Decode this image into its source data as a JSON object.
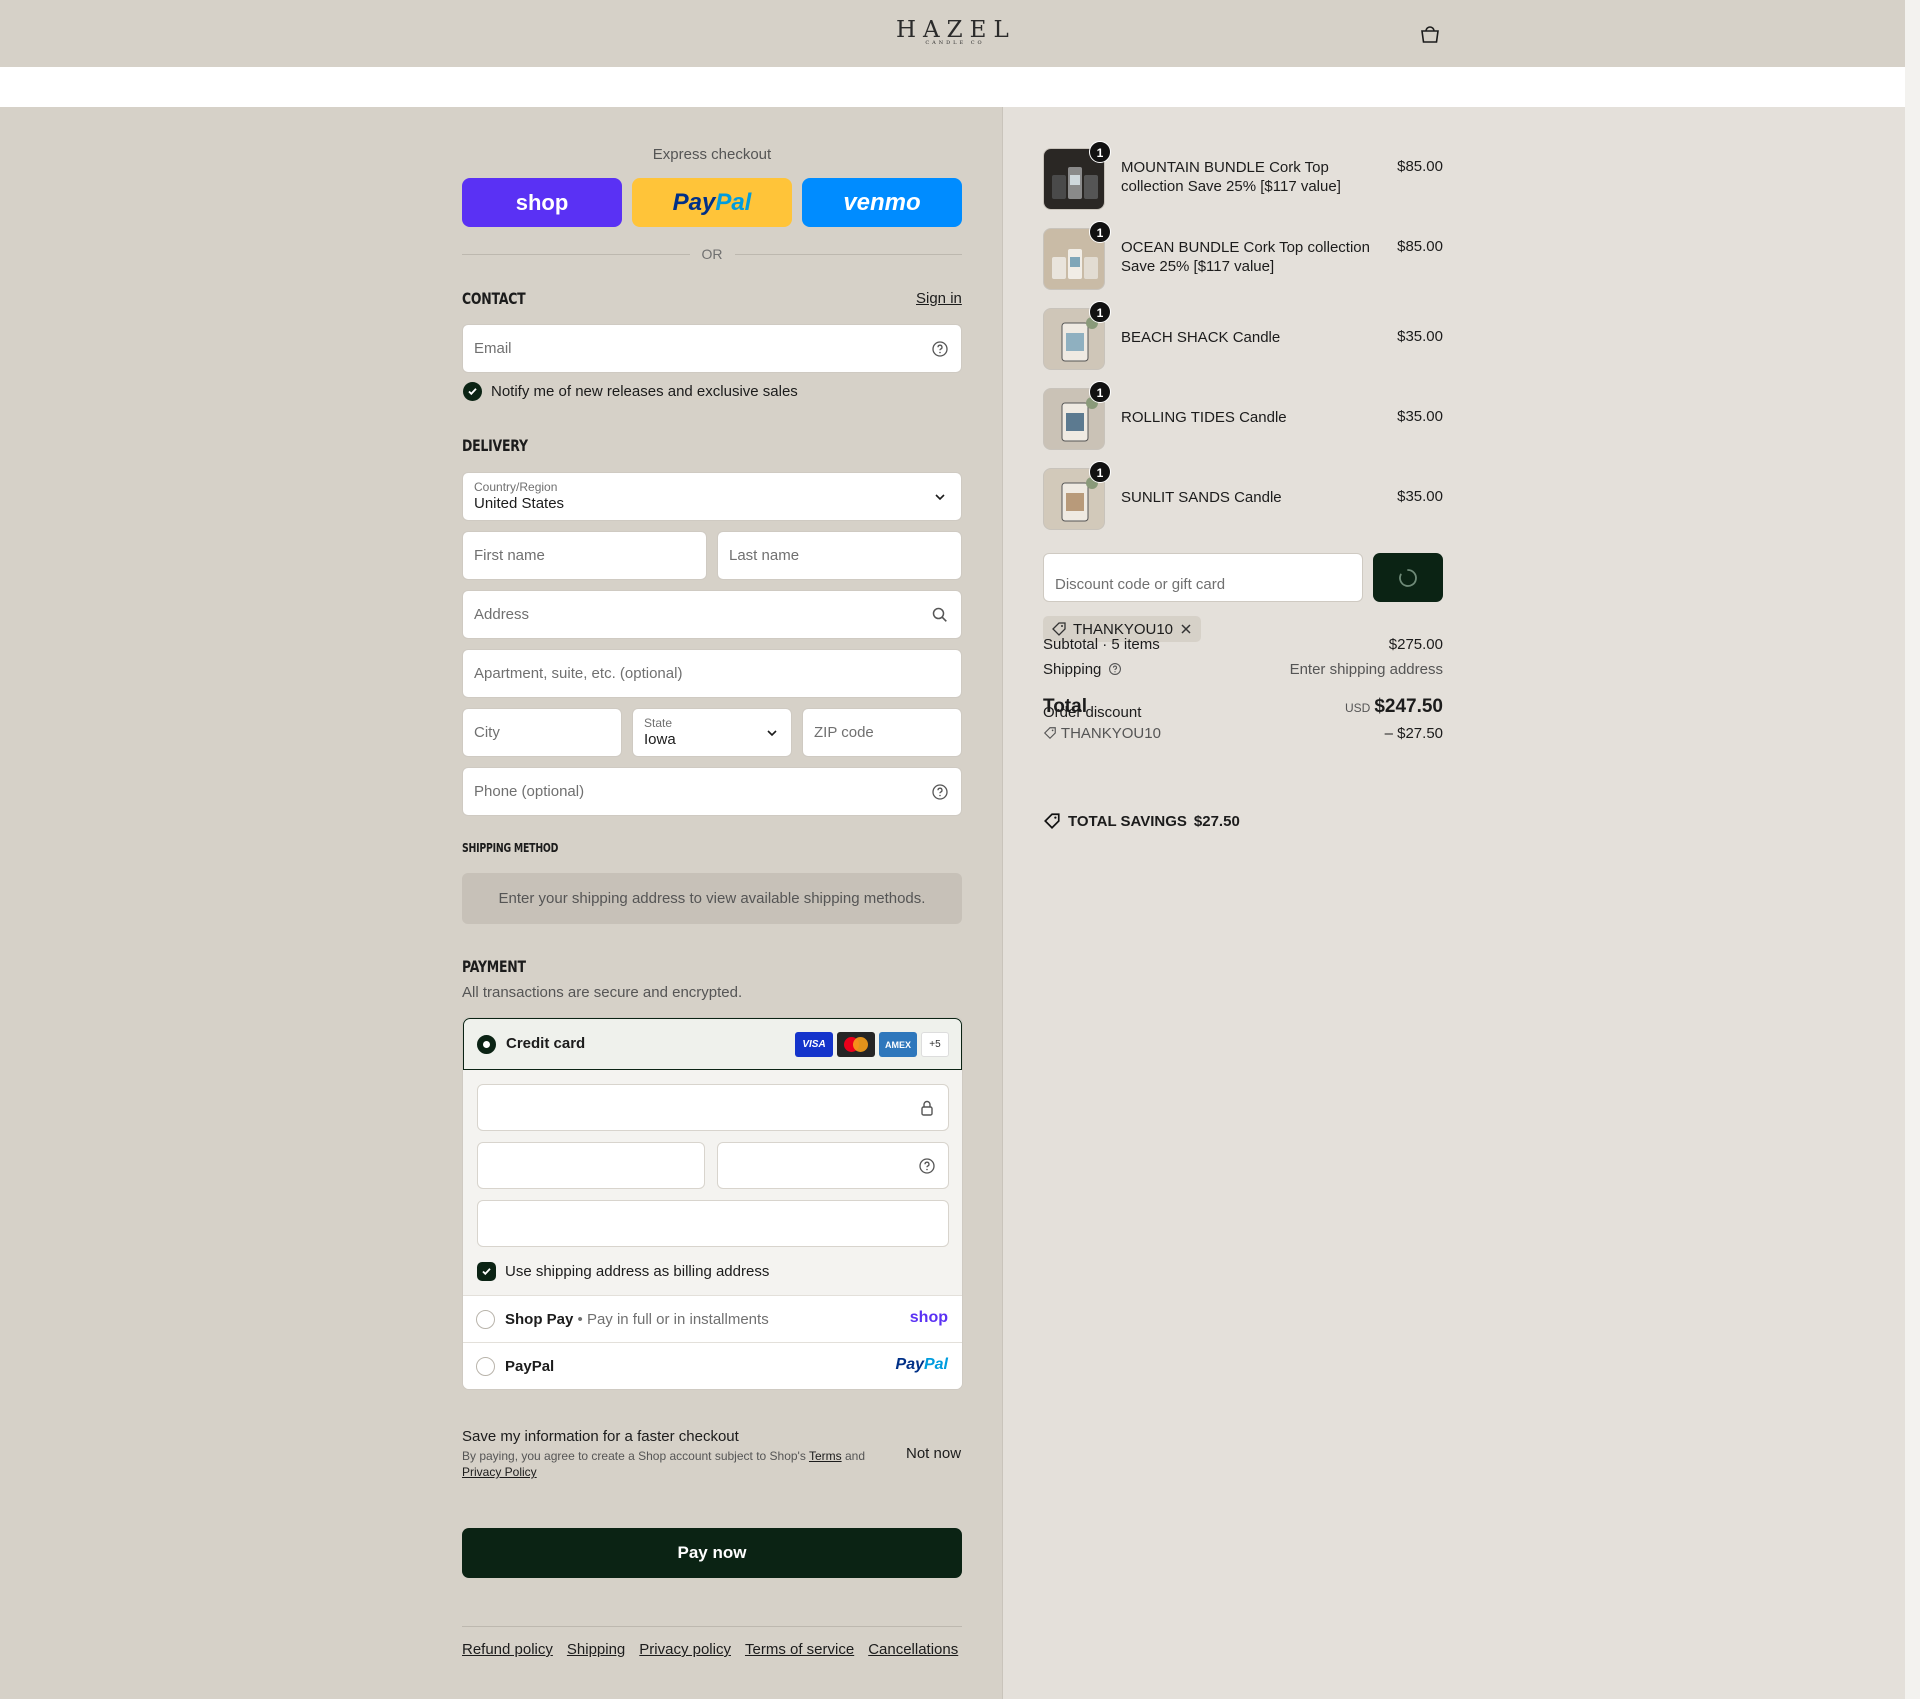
{
  "header": {
    "logo_main": "HAZEL",
    "logo_sub": "CANDLE CO",
    "cart_icon": "bag-icon"
  },
  "express": {
    "title": "Express checkout",
    "shop_label": "shop",
    "paypal_part1": "Pay",
    "paypal_part2": "Pal",
    "venmo_label": "venmo",
    "or_label": "OR"
  },
  "contact": {
    "heading": "CONTACT",
    "sign_in": "Sign in",
    "email_placeholder": "Email",
    "notify_label": "Notify me of new releases and exclusive sales"
  },
  "delivery": {
    "heading": "DELIVERY",
    "country_label": "Country/Region",
    "country_value": "United States",
    "first_name_placeholder": "First name",
    "last_name_placeholder": "Last name",
    "address_placeholder": "Address",
    "apartment_placeholder": "Apartment, suite, etc. (optional)",
    "city_placeholder": "City",
    "state_label": "State",
    "state_value": "Iowa",
    "zip_placeholder": "ZIP code",
    "phone_placeholder": "Phone (optional)"
  },
  "shipping_method": {
    "heading": "SHIPPING METHOD",
    "message": "Enter your shipping address to view available shipping methods."
  },
  "payment": {
    "heading": "PAYMENT",
    "subtitle": "All transactions are secure and encrypted.",
    "credit_card_label": "Credit card",
    "card_brands": [
      "VISA",
      "AMEX"
    ],
    "more_brands": "+5",
    "billing_label": "Use shipping address as billing address",
    "shop_pay_label": "Shop Pay",
    "shop_pay_sub": " • Pay in full or in installments",
    "shop_pay_brand": "shop",
    "paypal_label": "PayPal",
    "paypal_brand1": "Pay",
    "paypal_brand2": "Pal"
  },
  "save_info": {
    "title": "Save my information for a faster checkout",
    "legal_prefix": "By paying, you agree to create a Shop account subject to Shop's ",
    "terms": "Terms",
    "and": " and ",
    "privacy": "Privacy Policy",
    "not_now": "Not now"
  },
  "pay_now": "Pay now",
  "footer_links": [
    "Refund policy",
    "Shipping",
    "Privacy policy",
    "Terms of service",
    "Cancellations"
  ],
  "order": {
    "items": [
      {
        "name": "MOUNTAIN BUNDLE Cork Top collection Save 25% [$117 value]",
        "price": "$85.00",
        "qty": "1"
      },
      {
        "name": "OCEAN BUNDLE Cork Top collection Save 25% [$117 value]",
        "price": "$85.00",
        "qty": "1"
      },
      {
        "name": "BEACH SHACK Candle",
        "price": "$35.00",
        "qty": "1"
      },
      {
        "name": "ROLLING TIDES Candle",
        "price": "$35.00",
        "qty": "1"
      },
      {
        "name": "SUNLIT SANDS Candle",
        "price": "$35.00",
        "qty": "1"
      }
    ],
    "discount_placeholder": "Discount code or gift card",
    "applied_code": "THANKYOU10",
    "subtotal_label": "Subtotal · 5 items",
    "subtotal_value": "$275.00",
    "shipping_label": "Shipping",
    "shipping_value": "Enter shipping address",
    "total_label": "Total",
    "order_discount_label": "Order discount",
    "currency": "USD",
    "total_value": "$247.50",
    "discount_code": "THANKYOU10",
    "discount_value": "– $27.50",
    "savings_label": "TOTAL SAVINGS",
    "savings_value": "$27.50"
  },
  "colors": {
    "brand_dark": "#0b2314",
    "shop_purple": "#5a31f4",
    "paypal_yellow": "#ffc439",
    "venmo_blue": "#008cff"
  }
}
